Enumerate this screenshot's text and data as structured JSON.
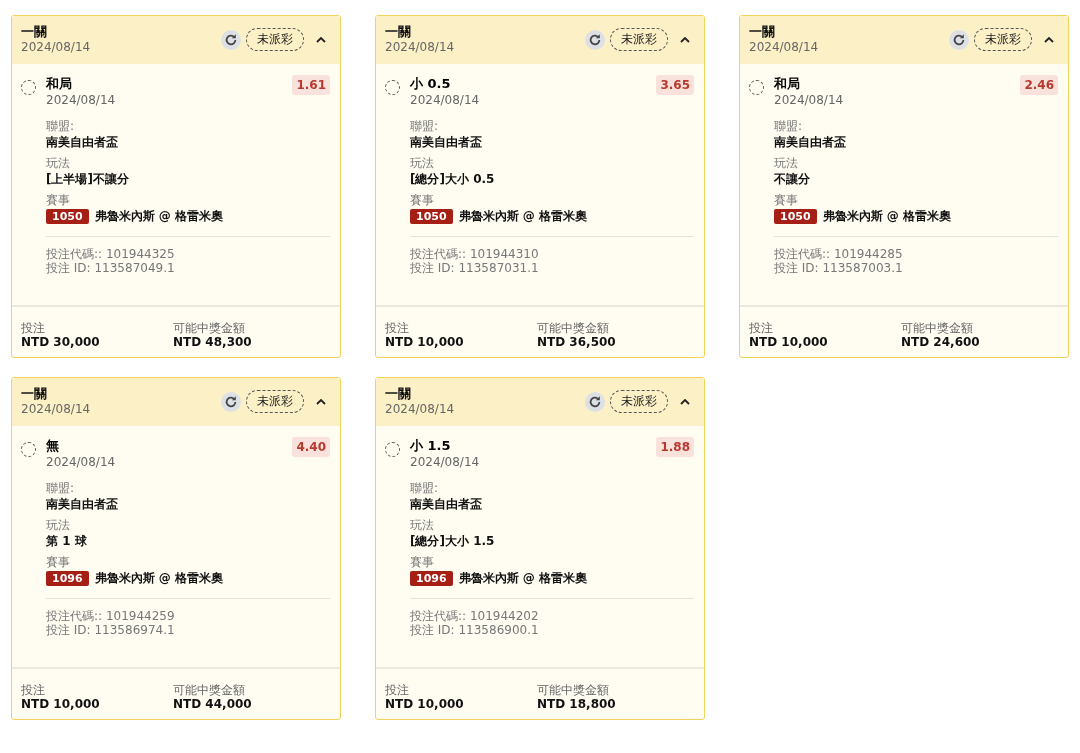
{
  "cards": [
    {
      "title": "一關",
      "date": "2024/08/14",
      "status": "未派彩",
      "expanded": true,
      "selection": "和局",
      "selection_date": "2024/08/14",
      "selected": false,
      "odds": "1.61",
      "league_label": "聯盟:",
      "league": "南美自由者盃",
      "market_label": "玩法",
      "market": "[上半場]不讓分",
      "event_label": "賽事",
      "event_no": "1050",
      "event": "弗魯米內斯 @ 格雷米奧",
      "bet_code": "投注代碼:: 101944325",
      "bet_id": "投注 ID: 113587049.1",
      "stake_label": "投注",
      "stake": "NTD 30,000",
      "payout_label": "可能中獎金額",
      "payout": "NTD 48,300"
    },
    {
      "title": "一關",
      "date": "2024/08/14",
      "status": "未派彩",
      "expanded": true,
      "selection": "小 0.5",
      "selection_date": "2024/08/14",
      "selected": false,
      "odds": "3.65",
      "league_label": "聯盟:",
      "league": "南美自由者盃",
      "market_label": "玩法",
      "market": "[總分]大小 0.5",
      "event_label": "賽事",
      "event_no": "1050",
      "event": "弗魯米內斯 @ 格雷米奧",
      "bet_code": "投注代碼:: 101944310",
      "bet_id": "投注 ID: 113587031.1",
      "stake_label": "投注",
      "stake": "NTD 10,000",
      "payout_label": "可能中獎金額",
      "payout": "NTD 36,500"
    },
    {
      "title": "一關",
      "date": "2024/08/14",
      "status": "未派彩",
      "expanded": true,
      "selection": "和局",
      "selection_date": "2024/08/14",
      "selected": false,
      "odds": "2.46",
      "league_label": "聯盟:",
      "league": "南美自由者盃",
      "market_label": "玩法",
      "market": "不讓分",
      "event_label": "賽事",
      "event_no": "1050",
      "event": "弗魯米內斯 @ 格雷米奧",
      "bet_code": "投注代碼:: 101944285",
      "bet_id": "投注 ID: 113587003.1",
      "stake_label": "投注",
      "stake": "NTD 10,000",
      "payout_label": "可能中獎金額",
      "payout": "NTD 24,600"
    },
    {
      "title": "一關",
      "date": "2024/08/14",
      "status": "未派彩",
      "expanded": true,
      "selection": "無",
      "selection_date": "2024/08/14",
      "selected": false,
      "odds": "4.40",
      "league_label": "聯盟:",
      "league": "南美自由者盃",
      "market_label": "玩法",
      "market": "第 1 球",
      "event_label": "賽事",
      "event_no": "1096",
      "event": "弗魯米內斯 @ 格雷米奧",
      "bet_code": "投注代碼:: 101944259",
      "bet_id": "投注 ID: 113586974.1",
      "stake_label": "投注",
      "stake": "NTD 10,000",
      "payout_label": "可能中獎金額",
      "payout": "NTD 44,000"
    },
    {
      "title": "一關",
      "date": "2024/08/14",
      "status": "未派彩",
      "expanded": true,
      "selection": "小 1.5",
      "selection_date": "2024/08/14",
      "selected": false,
      "odds": "1.88",
      "league_label": "聯盟:",
      "league": "南美自由者盃",
      "market_label": "玩法",
      "market": "[總分]大小 1.5",
      "event_label": "賽事",
      "event_no": "1096",
      "event": "弗魯米內斯 @ 格雷米奧",
      "bet_code": "投注代碼:: 101944202",
      "bet_id": "投注 ID: 113586900.1",
      "stake_label": "投注",
      "stake": "NTD 10,000",
      "payout_label": "可能中獎金額",
      "payout": "NTD 18,800"
    }
  ]
}
